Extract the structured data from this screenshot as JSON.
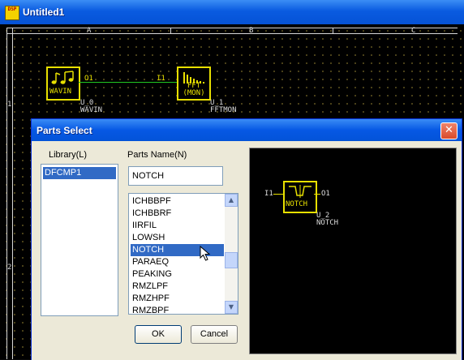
{
  "main_window": {
    "title": "Untitled1",
    "app_icon_text": "DSP"
  },
  "canvas": {
    "zone_columns": [
      "A",
      "B",
      "C"
    ],
    "zone_rows": [
      "1",
      "2"
    ],
    "components": [
      {
        "id": "U_0",
        "type": "WAVIN",
        "box_text": "WAVIN",
        "port_out": "O1",
        "icon": "music-notes-icon"
      },
      {
        "id": "U_1",
        "type": "FFTMON",
        "box_text": "FFT\n(MON)",
        "port_in": "I1",
        "icon": "spectrum-icon"
      }
    ]
  },
  "dialog": {
    "title": "Parts Select",
    "library_label": "Library(L)",
    "library_items": [
      "DFCMP1"
    ],
    "parts_name_label": "Parts Name(N)",
    "parts_name_value": "NOTCH",
    "parts_list": [
      "ICHBBPF",
      "ICHBBRF",
      "IIRFIL",
      "LOWSH",
      "NOTCH",
      "PARAEQ",
      "PEAKING",
      "RMZLPF",
      "RMZHPF",
      "RMZBPF"
    ],
    "selected_part": "NOTCH",
    "ok_label": "OK",
    "cancel_label": "Cancel",
    "preview": {
      "port_in": "I1",
      "port_out": "O1",
      "box_text": "NOTCH",
      "instance_id": "U_2",
      "instance_type": "NOTCH"
    }
  }
}
